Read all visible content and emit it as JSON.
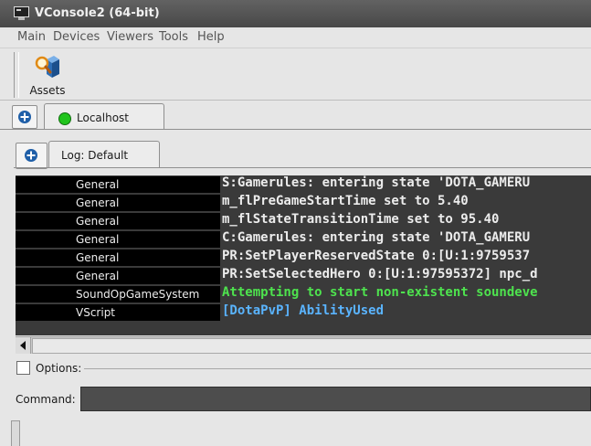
{
  "window": {
    "title": "VConsole2 (64-bit)"
  },
  "menu": [
    "Main",
    "Devices",
    "Viewers",
    "Tools",
    "Help"
  ],
  "toolbar": {
    "assets_label": "Assets",
    "assets_icon": "magnifier-cube-icon"
  },
  "connection_tabs": [
    {
      "label": "Localhost",
      "status_color": "#21c41d"
    }
  ],
  "log_tabs": [
    {
      "label": "Log: Default"
    }
  ],
  "log": [
    {
      "channel": "General",
      "message": "S:Gamerules: entering state 'DOTA_GAMERU",
      "color": "#ececec"
    },
    {
      "channel": "General",
      "message": "m_flPreGameStartTime set to 5.40",
      "color": "#ececec"
    },
    {
      "channel": "General",
      "message": "m_flStateTransitionTime set to 95.40",
      "color": "#ececec"
    },
    {
      "channel": "General",
      "message": "C:Gamerules: entering state 'DOTA_GAMERU",
      "color": "#ececec"
    },
    {
      "channel": "General",
      "message": "PR:SetPlayerReservedState 0:[U:1:9759537",
      "color": "#ececec"
    },
    {
      "channel": "General",
      "message": "PR:SetSelectedHero 0:[U:1:97595372] npc_d",
      "color": "#ececec"
    },
    {
      "channel": "SoundOpGameSystem",
      "message": "Attempting to start non-existent soundeve",
      "color": "#4ee34e"
    },
    {
      "channel": "VScript",
      "message": "[DotaPvP] AbilityUsed",
      "color": "#5ab4ff"
    }
  ],
  "options": {
    "label": "Options:",
    "checked": false
  },
  "command": {
    "label": "Command:",
    "value": ""
  }
}
